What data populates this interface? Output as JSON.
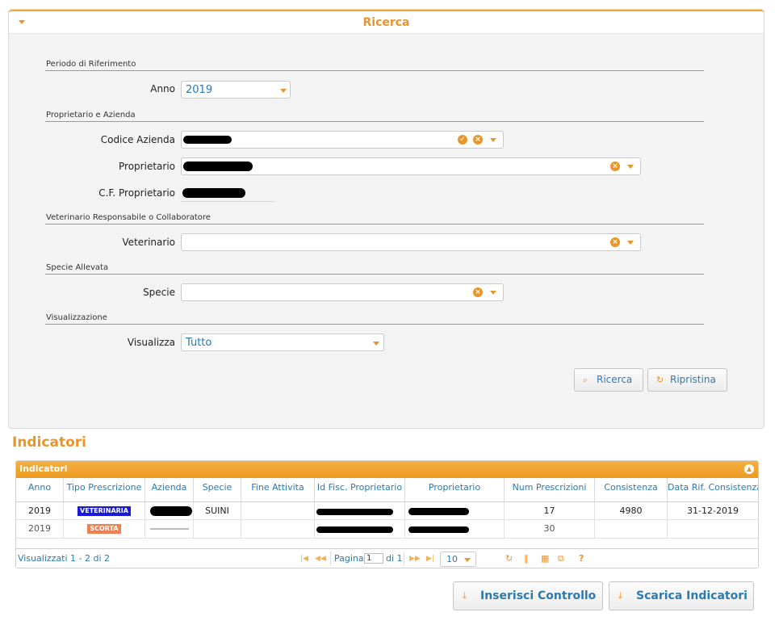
{
  "search": {
    "title": "Ricerca",
    "sections": {
      "periodo": "Periodo di Riferimento",
      "proprietario": "Proprietario e Azienda",
      "veterinario": "Veterinario Responsabile o Collaboratore",
      "specie": "Specie Allevata",
      "visualizzazione": "Visualizzazione"
    },
    "fields": {
      "anno_label": "Anno",
      "anno_value": "2019",
      "codice_label": "Codice Azienda",
      "proprietario_label": "Proprietario",
      "cf_label": "C.F. Proprietario",
      "veterinario_label": "Veterinario",
      "specie_label": "Specie",
      "visualizza_label": "Visualizza",
      "visualizza_value": "Tutto"
    },
    "buttons": {
      "search": "Ricerca",
      "reset": "Ripristina"
    }
  },
  "indicators": {
    "title": "Indicatori",
    "grid_caption": "Indicatori",
    "columns": [
      "Anno",
      "Tipo Prescrizione",
      "Azienda",
      "Specie",
      "Fine Attivita",
      "Id Fisc. Proprietario",
      "Proprietario",
      "Num Prescrizioni",
      "Consistenza",
      "Data Rif. Consistenza"
    ],
    "rows": [
      {
        "anno": "2019",
        "tipo": "VETERINARIA",
        "tipo_color": "#1a1ad6",
        "specie": "SUINI",
        "num": "17",
        "consistenza": "4980",
        "data_rif": "31-12-2019"
      },
      {
        "anno": "2019",
        "tipo": "SCORTA",
        "tipo_color": "#f08050",
        "specie": "",
        "num": "30",
        "consistenza": "",
        "data_rif": ""
      }
    ],
    "pager": {
      "summary": "Visualizzati 1 - 2 di 2",
      "page_label": "Pagina",
      "page_value": "1",
      "of_label": "di 1",
      "page_size": "10"
    }
  },
  "actions": {
    "insert": "Inserisci Controllo",
    "download": "Scarica Indicatori"
  },
  "colors": {
    "accent": "#e8952a",
    "link": "#2a7ab0"
  },
  "icons": [
    "collapse-caret-icon",
    "check-circle-icon",
    "clear-circle-icon",
    "dropdown-caret-icon",
    "search-icon",
    "refresh-icon",
    "download-icon",
    "first-page-icon",
    "prev-page-icon",
    "next-page-icon",
    "last-page-icon",
    "reload-icon",
    "columns-icon",
    "table-icon",
    "export-icon",
    "help-icon"
  ]
}
